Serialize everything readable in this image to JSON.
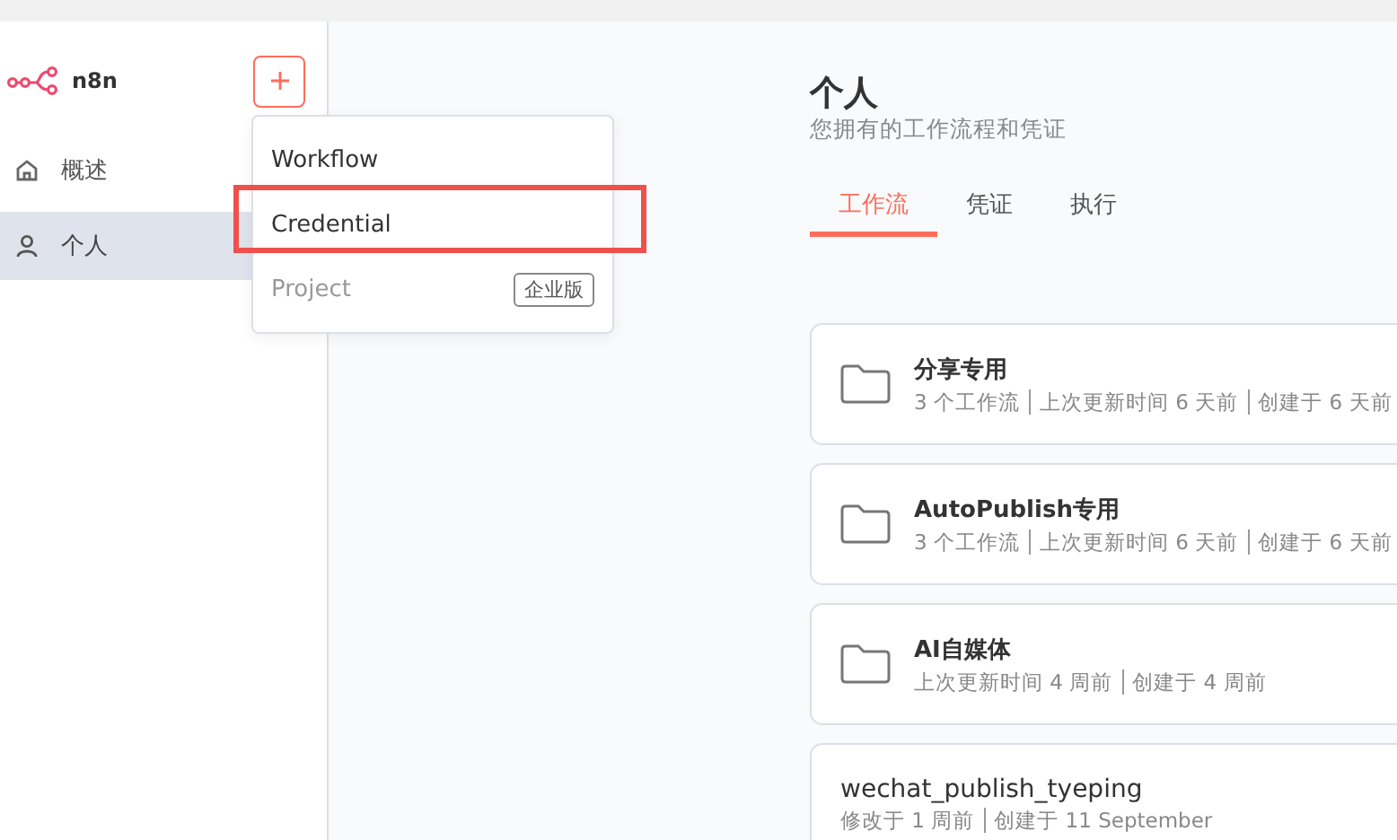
{
  "sidebar": {
    "logo": "n8n",
    "items": [
      {
        "label": "概述",
        "kind": "home",
        "selected": false
      },
      {
        "label": "个人",
        "kind": "user",
        "selected": true
      }
    ]
  },
  "create_menu": {
    "open": true,
    "items": [
      {
        "label": "Workflow",
        "disabled": false,
        "highlighted": false
      },
      {
        "label": "Credential",
        "disabled": false,
        "highlighted": true
      },
      {
        "label": "Project",
        "disabled": true,
        "highlighted": false,
        "badge": "企业版"
      }
    ]
  },
  "header": {
    "title": "个人",
    "subtitle": "您拥有的工作流程和凭证"
  },
  "tabs": [
    {
      "label": "工作流",
      "selected": true
    },
    {
      "label": "凭证",
      "selected": false
    },
    {
      "label": "执行",
      "selected": false
    }
  ],
  "cards": [
    {
      "kind": "folder",
      "title": "分享专用",
      "meta": [
        "3 个工作流",
        "上次更新时间 6 天前",
        "创建于 6 天前"
      ]
    },
    {
      "kind": "folder",
      "title": "AutoPublish专用",
      "meta": [
        "3 个工作流",
        "上次更新时间 6 天前",
        "创建于 6 天前"
      ]
    },
    {
      "kind": "folder",
      "title": "AI自媒体",
      "meta": [
        "上次更新时间 4 周前",
        "创建于 4 周前"
      ]
    },
    {
      "kind": "workflow",
      "title": "wechat_publish_tyeping",
      "meta": [
        "修改于 1 周前",
        "创建于 11 September"
      ]
    }
  ]
}
